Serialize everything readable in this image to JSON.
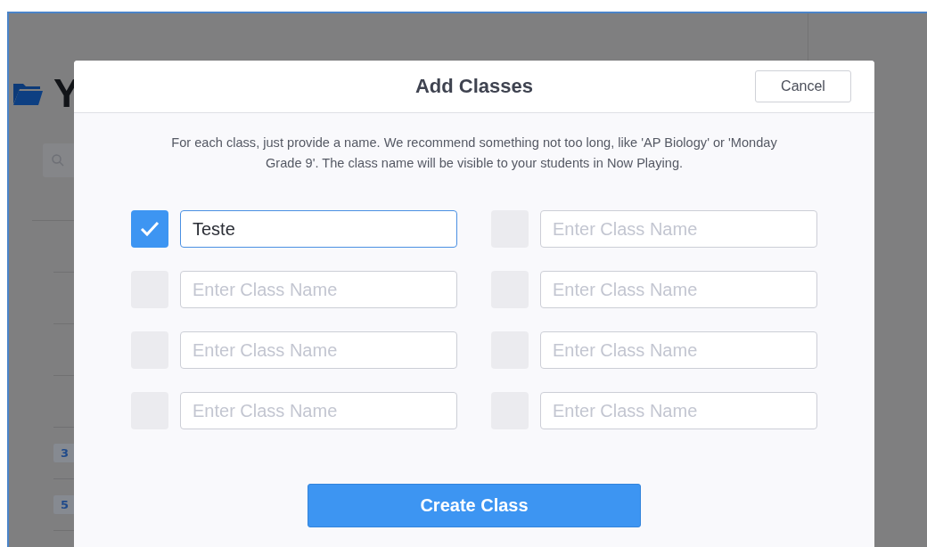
{
  "page": {
    "heading": "Y",
    "badges": [
      "3",
      "5"
    ]
  },
  "dialog": {
    "title": "Add Classes",
    "cancel": "Cancel",
    "description": "For each class, just provide a name. We recommend something not too long, like 'AP Biology' or 'Monday Grade 9'. The class name will be visible to your students in Now Playing.",
    "classes": [
      {
        "checked": true,
        "value": "Teste",
        "focused": true
      },
      {
        "checked": false,
        "placeholder": "Enter Class Name",
        "focused": false
      },
      {
        "checked": false,
        "placeholder": "Enter Class Name",
        "focused": false
      },
      {
        "checked": false,
        "placeholder": "Enter Class Name",
        "focused": false
      },
      {
        "checked": false,
        "placeholder": "Enter Class Name",
        "focused": false
      },
      {
        "checked": false,
        "placeholder": "Enter Class Name",
        "focused": false
      },
      {
        "checked": false,
        "placeholder": "Enter Class Name",
        "focused": false
      },
      {
        "checked": false,
        "placeholder": "Enter Class Name",
        "focused": false
      }
    ],
    "create": "Create Class"
  }
}
